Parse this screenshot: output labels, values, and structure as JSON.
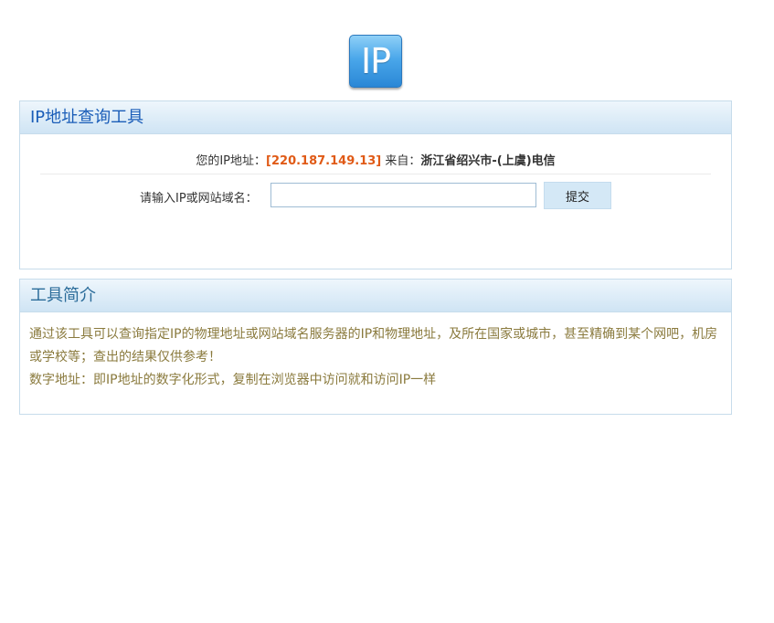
{
  "logo": {
    "text": "IP",
    "color": "#4aa7ea"
  },
  "query_panel": {
    "title": "IP地址查询工具",
    "your_ip_prefix": "您的IP地址：",
    "your_ip_value": "[220.187.149.13]",
    "from_label": " 来自：",
    "location": "浙江省绍兴市-(上虞)电信",
    "input_label": "请输入IP或网站域名：",
    "input_value": "",
    "input_placeholder": "",
    "submit_label": "提交"
  },
  "intro_panel": {
    "title": "工具简介",
    "paragraph1": "通过该工具可以查询指定IP的物理地址或网站域名服务器的IP和物理地址，及所在国家或城市，甚至精确到某个网吧，机房或学校等；查出的结果仅供参考！",
    "paragraph2": "数字地址：即IP地址的数字化形式，复制在浏览器中访问就和访问IP一样"
  },
  "colors": {
    "ip_highlight": "#e05a16",
    "title_blue": "#1a5db8",
    "intro_text": "#8a7a3d",
    "panel_border": "#c7dceb"
  }
}
